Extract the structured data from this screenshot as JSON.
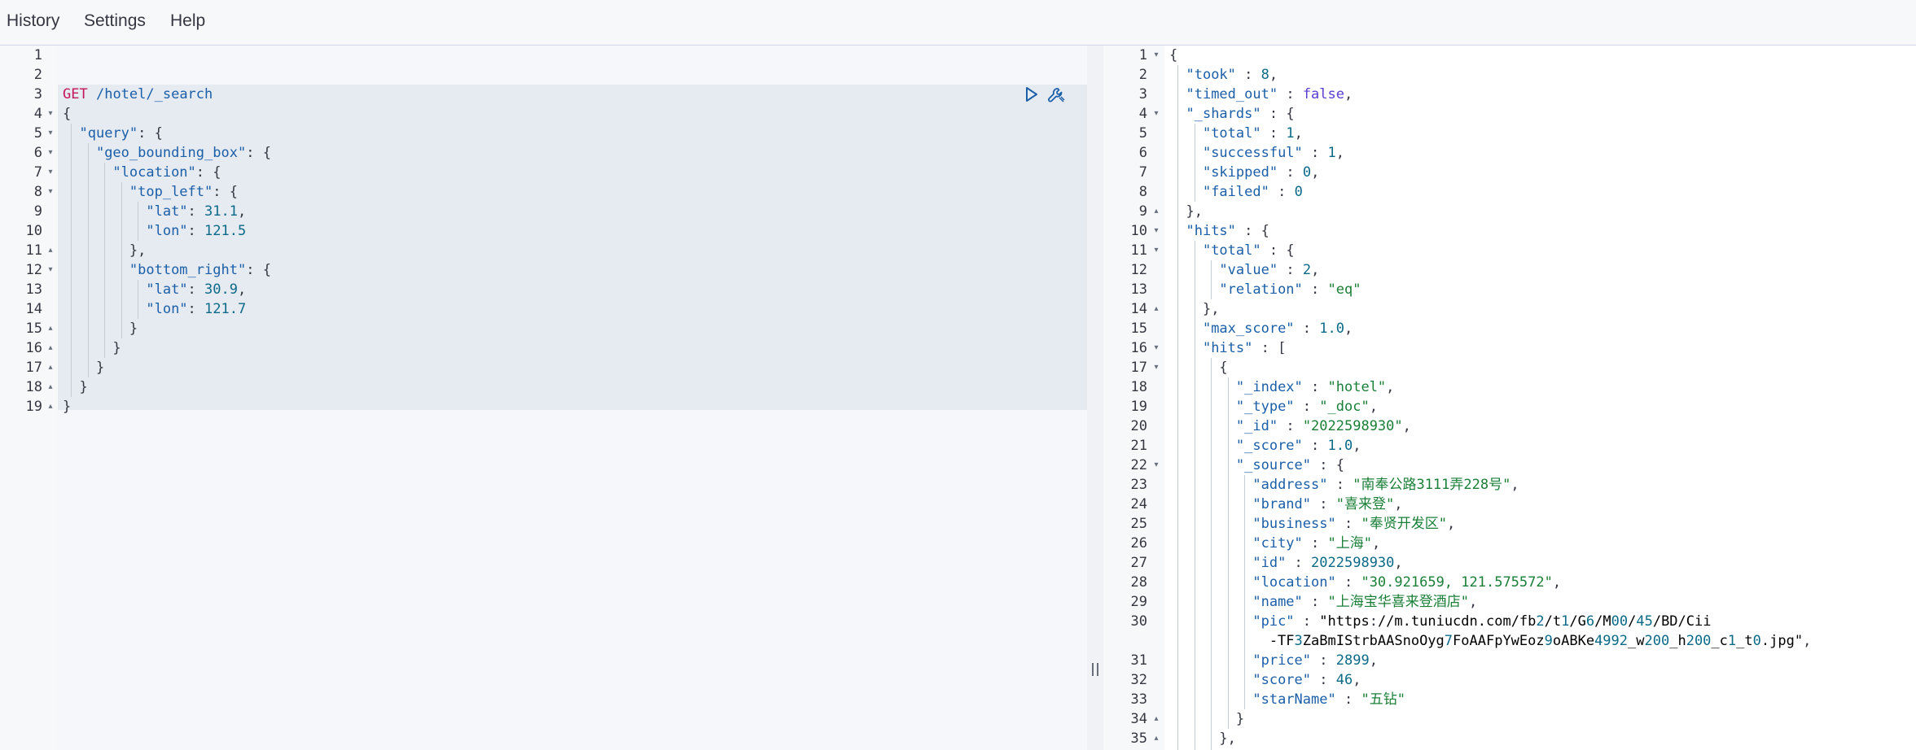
{
  "menu": {
    "history": "History",
    "settings": "Settings",
    "help": "Help"
  },
  "request": {
    "line_numbers": [
      "1",
      "2",
      "3",
      "4",
      "5",
      "6",
      "7",
      "8",
      "9",
      "10",
      "11",
      "12",
      "13",
      "14",
      "15",
      "16",
      "17",
      "18",
      "19"
    ],
    "method": "GET",
    "path": "/hotel/_search",
    "body_lines": [
      "{",
      "  \"query\": {",
      "    \"geo_bounding_box\": {",
      "      \"location\": {",
      "        \"top_left\": {",
      "          \"lat\": 31.1,",
      "          \"lon\": 121.5",
      "        },",
      "        \"bottom_right\": {",
      "          \"lat\": 30.9,",
      "          \"lon\": 121.7",
      "        }",
      "      }",
      "    }",
      "  }",
      "}"
    ],
    "actions": {
      "run": "play-icon",
      "settings": "wrench-icon"
    }
  },
  "response": {
    "line_numbers": [
      "1",
      "2",
      "3",
      "4",
      "5",
      "6",
      "7",
      "8",
      "9",
      "10",
      "11",
      "12",
      "13",
      "14",
      "15",
      "16",
      "17",
      "18",
      "19",
      "20",
      "21",
      "22",
      "23",
      "24",
      "25",
      "26",
      "27",
      "28",
      "29",
      "30",
      "",
      "31",
      "32",
      "33",
      "34",
      "35"
    ],
    "lines": [
      "{",
      "  \"took\" : 8,",
      "  \"timed_out\" : false,",
      "  \"_shards\" : {",
      "    \"total\" : 1,",
      "    \"successful\" : 1,",
      "    \"skipped\" : 0,",
      "    \"failed\" : 0",
      "  },",
      "  \"hits\" : {",
      "    \"total\" : {",
      "      \"value\" : 2,",
      "      \"relation\" : \"eq\"",
      "    },",
      "    \"max_score\" : 1.0,",
      "    \"hits\" : [",
      "      {",
      "        \"_index\" : \"hotel\",",
      "        \"_type\" : \"_doc\",",
      "        \"_id\" : \"2022598930\",",
      "        \"_score\" : 1.0,",
      "        \"_source\" : {",
      "          \"address\" : \"南奉公路3111弄228号\",",
      "          \"brand\" : \"喜来登\",",
      "          \"business\" : \"奉贤开发区\",",
      "          \"city\" : \"上海\",",
      "          \"id\" : 2022598930,",
      "          \"location\" : \"30.921659, 121.575572\",",
      "          \"name\" : \"上海宝华喜来登酒店\",",
      "          \"pic\" : \"https://m.tuniucdn.com/fb2/t1/G6/M00/45/BD/Cii",
      "            -TF3ZaBmIStrbAASnoOyg7FoAAFpYwEoz9oABKe4992_w200_h200_c1_t0.jpg\",",
      "          \"price\" : 2899,",
      "          \"score\" : 46,",
      "          \"starName\" : \"五钻\"",
      "        }",
      "      },"
    ]
  },
  "colors": {
    "key": "#1b5fa8",
    "string": "#1a7f37",
    "number": "#0b6a88",
    "boolean": "#5a3dd1",
    "method": "#c4145a"
  }
}
